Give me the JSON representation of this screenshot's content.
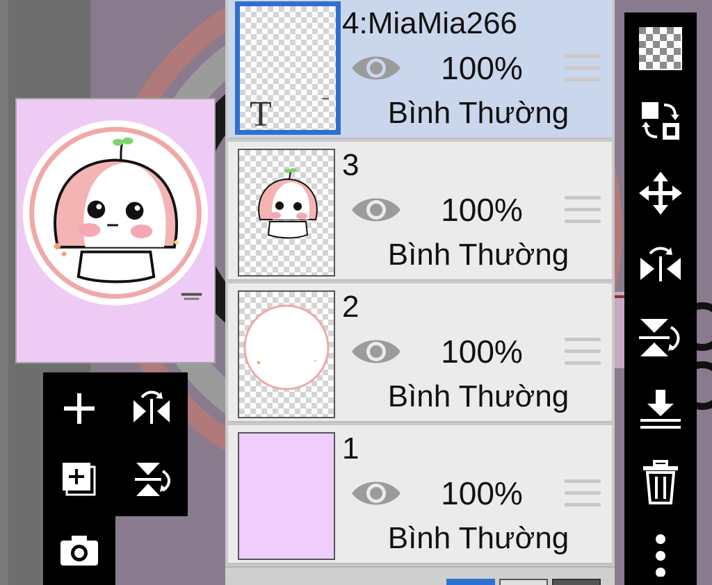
{
  "layers": [
    {
      "name": "4:MiaMia266",
      "opacity": "100%",
      "blend": "Bình Thường",
      "selected": true,
      "thumb_text": "T"
    },
    {
      "name": "3",
      "opacity": "100%",
      "blend": "Bình Thường",
      "selected": false
    },
    {
      "name": "2",
      "opacity": "100%",
      "blend": "Bình Thường",
      "selected": false
    },
    {
      "name": "1",
      "opacity": "100%",
      "blend": "Bình Thường",
      "selected": false
    }
  ],
  "left_tools": [
    "add-layer-icon",
    "flip-horizontal-icon",
    "duplicate-layer-icon",
    "flip-vertical-icon",
    "camera-icon"
  ],
  "right_tools": [
    "transparency-icon",
    "swap-layers-icon",
    "move-icon",
    "flip-horizontal-icon",
    "flip-vertical-icon",
    "merge-down-icon",
    "trash-icon",
    "more-icon"
  ],
  "colors": {
    "selected_row": "#c9d6ec",
    "selected_border": "#2f6fd0",
    "preview_bg": "#eecbf5",
    "ring": "#f0a8a8"
  }
}
